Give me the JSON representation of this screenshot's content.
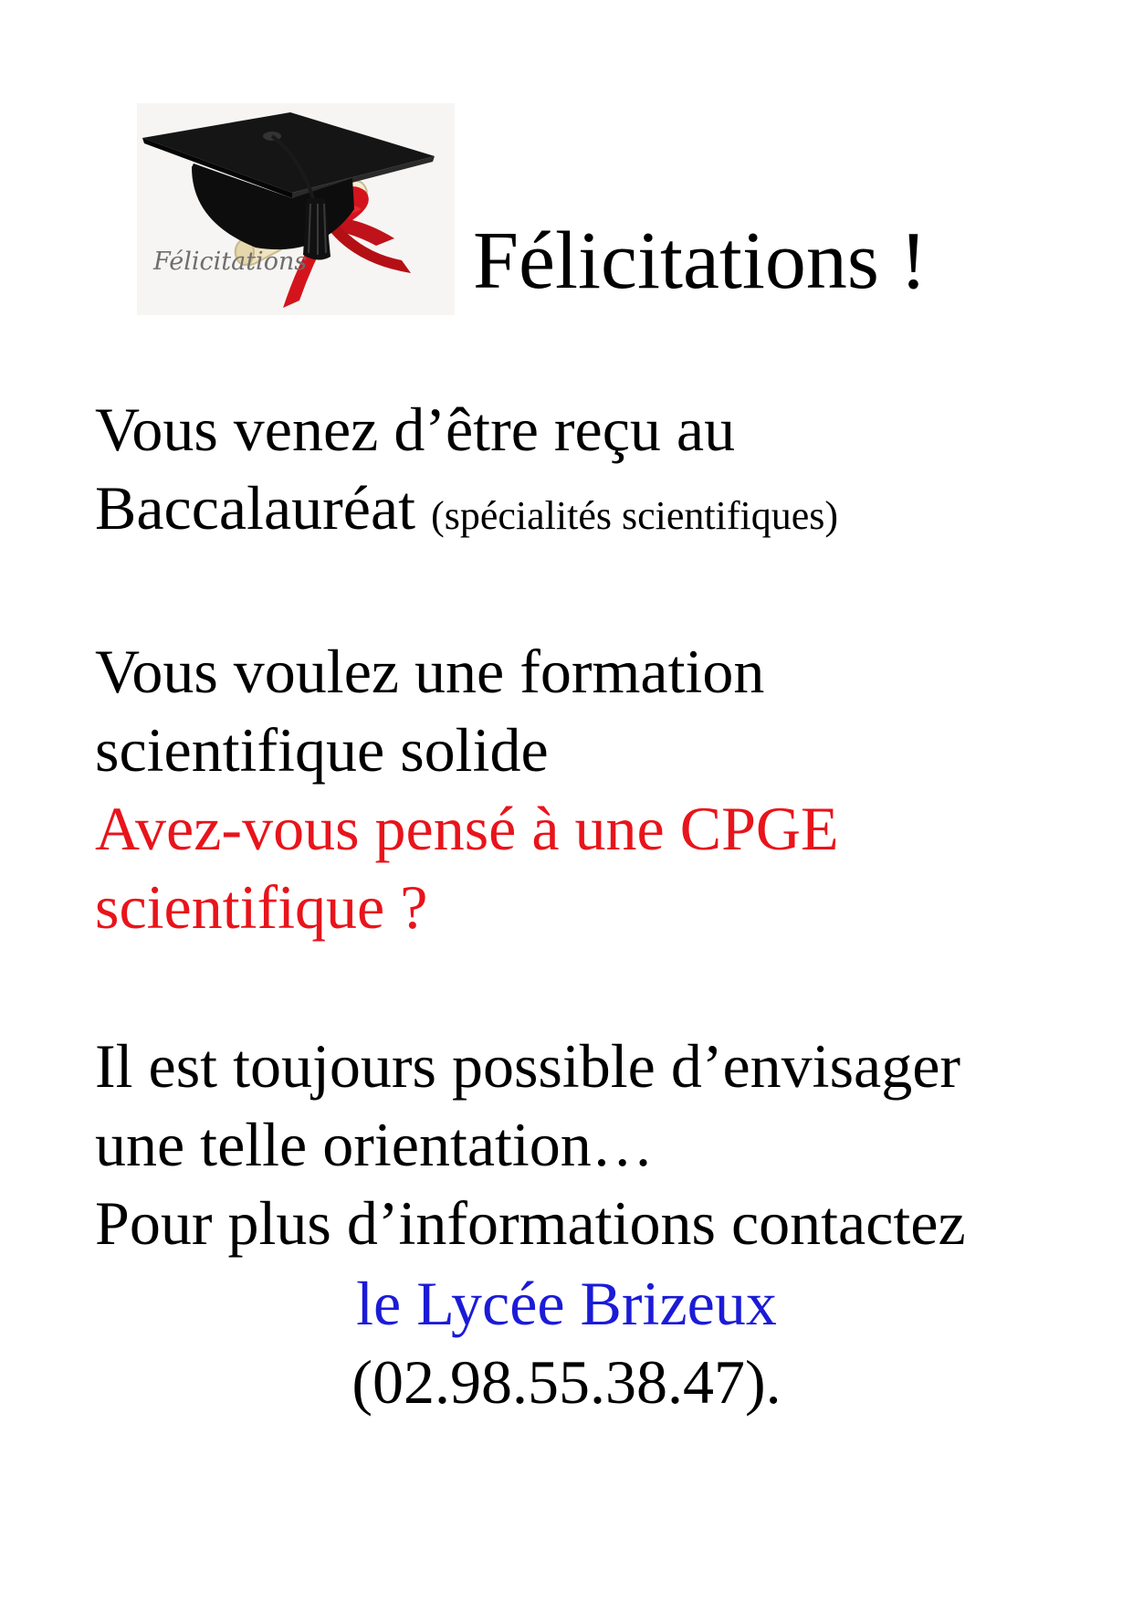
{
  "logo": {
    "script_text": "Félicitations",
    "icon": "graduation-cap-diploma-icon",
    "colors": {
      "cap": "#111111",
      "ribbon": "#d4141c",
      "scroll": "#efe3c0",
      "script": "#6e6e6e"
    }
  },
  "title": "Félicitations !",
  "para1": {
    "line1": "Vous venez d’être reçu au",
    "line2_main": "Baccalauréat",
    "line2_small": "(spécialités scientifiques)"
  },
  "para2": {
    "line1": "Vous voulez une formation",
    "line2": "scientifique solide",
    "question_line1": "Avez-vous pensé à une CPGE",
    "question_line2": "scientifique ?"
  },
  "para3": {
    "line1": "Il est toujours possible d’envisager",
    "line2": "une telle orientation…",
    "line3": "Pour plus d’informations contactez",
    "school": "le Lycée Brizeux",
    "phone": "(02.98.55.38.47)."
  },
  "colors": {
    "accent_red": "#e8141b",
    "link_blue": "#1b1bd8",
    "text": "#000000"
  }
}
